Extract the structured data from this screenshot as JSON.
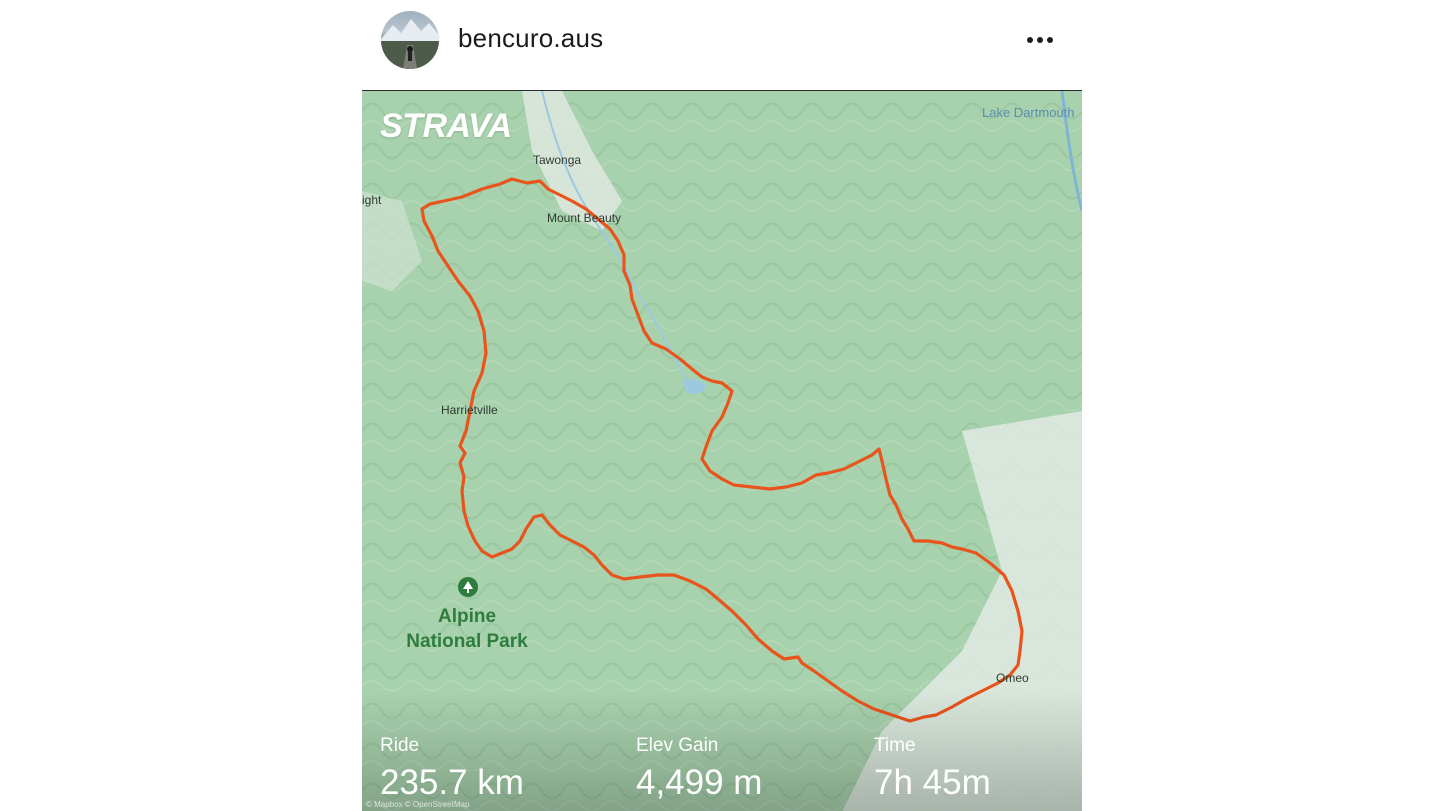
{
  "post": {
    "username": "bencuro.aus",
    "more_icon": "more-horizontal-icon"
  },
  "map": {
    "brand": "STRAVA",
    "places": {
      "tawonga": "Tawonga",
      "mount_beauty": "Mount Beauty",
      "bright": "ight",
      "harrietville": "Harrietville",
      "omeo": "Omeo",
      "lake": "Lake Dartmouth"
    },
    "park_line1": "Alpine",
    "park_line2": "National Park",
    "park_icon": "tree-icon",
    "route_color": "#e8541c",
    "attribution": "© Mapbox © OpenStreetMap"
  },
  "stats": {
    "ride_label": "Ride",
    "ride_value": "235.7 km",
    "elev_label": "Elev Gain",
    "elev_value": "4,499 m",
    "time_label": "Time",
    "time_value": "7h 45m"
  },
  "colors": {
    "map_green": "#a9d2ae",
    "route": "#e8541c",
    "park_text": "#2e7d3e"
  }
}
